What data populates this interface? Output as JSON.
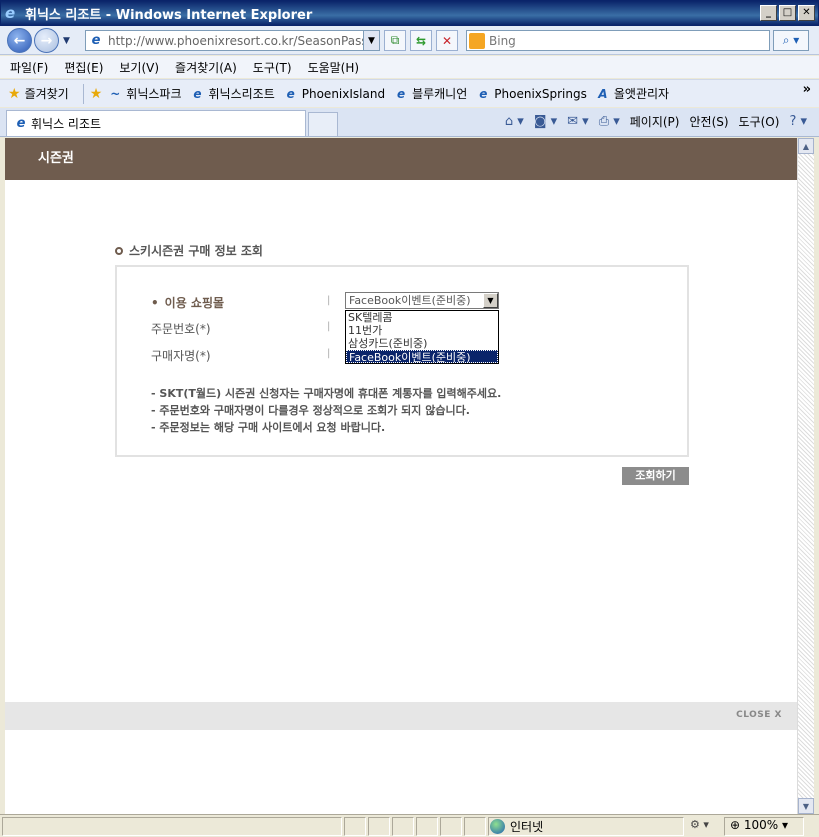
{
  "window": {
    "title": "휘닉스 리조트 - Windows Internet Explorer",
    "minimize": "_",
    "maximize": "□",
    "close": "✕"
  },
  "address": {
    "url": "http://www.phoenixresort.co.kr/SeasonPass",
    "search_placeholder": "Bing"
  },
  "menu": {
    "items": [
      "파일(F)",
      "편집(E)",
      "보기(V)",
      "즐겨찾기(A)",
      "도구(T)",
      "도움말(H)"
    ]
  },
  "favorites": {
    "label": "즐겨찾기",
    "items": [
      "휘닉스파크",
      "휘닉스리조트",
      "PhoenixIsland",
      "블루캐니언",
      "PhoenixSprings",
      "올앳관리자"
    ],
    "overflow": "»"
  },
  "tabs": {
    "active": "휘닉스 리조트"
  },
  "command_bar": {
    "page": "페이지(P)",
    "safety": "안전(S)",
    "tools": "도구(O)"
  },
  "page": {
    "header_title": "시즌권",
    "section_title": "스키시즌권 구매 정보 조회",
    "fields": {
      "mall_label": "이용 쇼핑몰",
      "order_label": "주문번호(*)",
      "buyer_label": "구매자명(*)"
    },
    "select": {
      "value": "FaceBook이벤트(준비중)",
      "options": [
        "SK텔레콤",
        "11번가",
        "삼성카드(준비중)",
        "FaceBook이벤트(준비중)"
      ]
    },
    "notes": [
      "- SKT(T월드) 시즌권 신청자는 구매자명에 휴대폰 계통자를 입력해주세요.",
      "- 주문번호와 구매자명이 다를경우 정상적으로 조회가 되지 않습니다.",
      "- 주문정보는 해당 구매 사이트에서 요청 바랍니다."
    ],
    "search_button": "조회하기",
    "close_label": "CLOSE X"
  },
  "status": {
    "zone": "인터넷",
    "zoom": "100%"
  },
  "colors": {
    "brand": "#6f5c4e",
    "button": "#8c8c8c",
    "selection": "#0a246a"
  }
}
